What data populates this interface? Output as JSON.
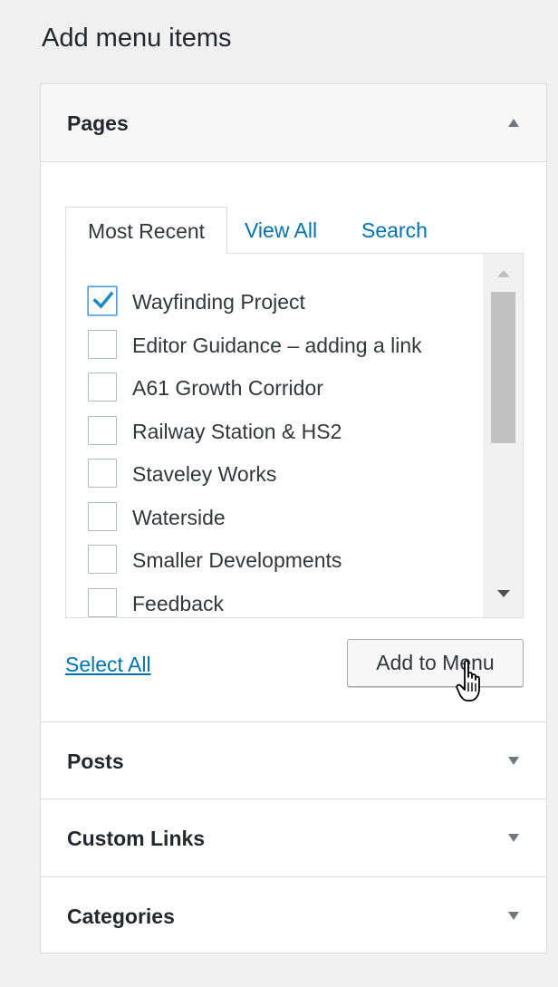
{
  "page_title": "Add menu items",
  "sections": {
    "pages": {
      "title": "Pages",
      "tabs": {
        "most_recent": "Most Recent",
        "view_all": "View All",
        "search": "Search"
      },
      "items": [
        {
          "label": "Wayfinding Project",
          "checked": true
        },
        {
          "label": "Editor Guidance – adding a link",
          "checked": false
        },
        {
          "label": "A61 Growth Corridor",
          "checked": false
        },
        {
          "label": "Railway Station & HS2",
          "checked": false
        },
        {
          "label": "Staveley Works",
          "checked": false
        },
        {
          "label": "Waterside",
          "checked": false
        },
        {
          "label": "Smaller Developments",
          "checked": false
        },
        {
          "label": "Feedback",
          "checked": false
        }
      ],
      "select_all_label": "Select All",
      "add_button_label": "Add to Menu"
    },
    "posts": {
      "title": "Posts"
    },
    "custom_links": {
      "title": "Custom Links"
    },
    "categories": {
      "title": "Categories"
    }
  },
  "icons": {
    "checkmark": "checkmark-icon",
    "cursor": "hand-pointer-cursor-icon",
    "collapse": "arrow-up-icon",
    "expand": "arrow-down-icon"
  },
  "colors": {
    "link": "#0073aa",
    "checkmark": "#1e8cbe",
    "background": "#f1f1f1"
  }
}
